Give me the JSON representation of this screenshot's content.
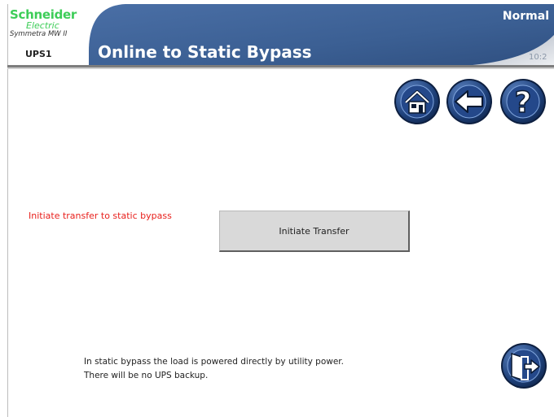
{
  "header": {
    "brand_name": "Schneider",
    "brand_sub": "Electric",
    "product_model": "Symmetra MW II",
    "device_name": "UPS1",
    "page_title": "Online to Static Bypass",
    "status": "Normal",
    "clock": "10:2"
  },
  "nav": {
    "home_icon": "home-icon",
    "back_icon": "back-arrow-icon",
    "help_icon": "help-icon",
    "exit_icon": "exit-door-icon"
  },
  "content": {
    "prompt_label": "Initiate transfer to static bypass",
    "action_button_label": "Initiate Transfer",
    "info_line_1": "In static bypass the load is powered directly by utility power.",
    "info_line_2": "There will be no UPS backup."
  },
  "colors": {
    "header_blue": "#3b5f93",
    "brand_green": "#3dcd58",
    "warning_red": "#e8201c",
    "button_gray": "#d9d9d9"
  }
}
